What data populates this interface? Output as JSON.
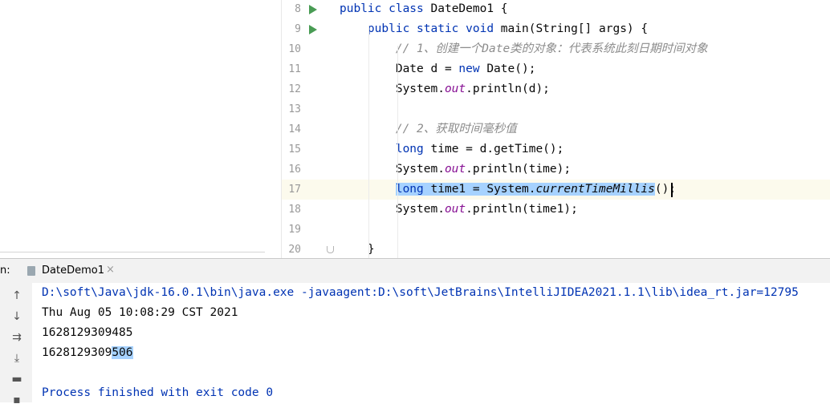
{
  "editor": {
    "lines": [
      {
        "no": "8",
        "tokens": [
          [
            "kw",
            "public class "
          ],
          [
            "",
            "DateDemo1 {"
          ]
        ],
        "run": true
      },
      {
        "no": "9",
        "tokens": [
          [
            "",
            "    "
          ],
          [
            "kw",
            "public static void "
          ],
          [
            "",
            "main(String[] args) {"
          ]
        ],
        "run": true
      },
      {
        "no": "10",
        "tokens": [
          [
            "",
            "        "
          ],
          [
            "cm",
            "// 1、创建一个Date类的对象：代表系统此刻日期时间对象"
          ]
        ]
      },
      {
        "no": "11",
        "tokens": [
          [
            "",
            "        Date d = "
          ],
          [
            "kw",
            "new "
          ],
          [
            "",
            "Date();"
          ]
        ]
      },
      {
        "no": "12",
        "tokens": [
          [
            "",
            "        System."
          ],
          [
            "st",
            "out"
          ],
          [
            "",
            ".println(d);"
          ]
        ]
      },
      {
        "no": "13",
        "tokens": []
      },
      {
        "no": "14",
        "tokens": [
          [
            "",
            "        "
          ],
          [
            "cm",
            "// 2、获取时间毫秒值"
          ]
        ]
      },
      {
        "no": "15",
        "tokens": [
          [
            "",
            "        "
          ],
          [
            "kw",
            "long "
          ],
          [
            "",
            "time = d.getTime();"
          ]
        ]
      },
      {
        "no": "16",
        "tokens": [
          [
            "",
            "        System."
          ],
          [
            "st",
            "out"
          ],
          [
            "",
            ".println(time);"
          ]
        ]
      },
      {
        "no": "17",
        "tokens": [
          [
            "",
            "        "
          ],
          [
            "sel-kw",
            "long "
          ],
          [
            "sel",
            "time1 = System."
          ],
          [
            "sel-it",
            "currentTimeMillis"
          ],
          [
            "",
            "();"
          ]
        ],
        "current": true
      },
      {
        "no": "18",
        "tokens": [
          [
            "",
            "        System."
          ],
          [
            "st",
            "out"
          ],
          [
            "",
            ".println(time1);"
          ]
        ]
      },
      {
        "no": "19",
        "tokens": []
      },
      {
        "no": "20",
        "tokens": [
          [
            "",
            "    }"
          ]
        ]
      }
    ]
  },
  "run": {
    "label": "n:",
    "tab_label": "DateDemo1",
    "close_glyph": "×",
    "toolbar": [
      {
        "icon": "up-arrow-icon",
        "glyph": "↑"
      },
      {
        "icon": "down-arrow-icon",
        "glyph": "↓"
      },
      {
        "icon": "soft-wrap-icon",
        "glyph": "⇉"
      },
      {
        "icon": "scroll-to-end-icon",
        "glyph": "⤓"
      },
      {
        "icon": "print-icon",
        "glyph": "▬"
      },
      {
        "icon": "delete-icon",
        "glyph": "▪"
      }
    ],
    "output": {
      "command": "D:\\soft\\Java\\jdk-16.0.1\\bin\\java.exe -javaagent:D:\\soft\\JetBrains\\IntelliJIDEA2021.1.1\\lib\\idea_rt.jar=12795",
      "line1": "Thu Aug 05 10:08:29 CST 2021",
      "line2": "1628129309485",
      "line3_prefix": "1628129309",
      "line3_selected": "506",
      "exit": "Process finished with exit code 0"
    }
  }
}
